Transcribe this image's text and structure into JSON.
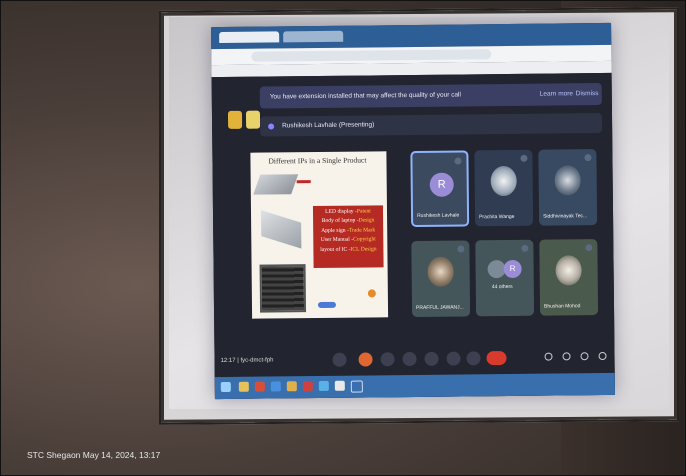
{
  "meeting_code": "fyc-dmct-fph",
  "time": "12:17",
  "banner": {
    "message": "You have extension installed that may affect the quality of your call",
    "learn_more": "Learn more",
    "dismiss": "Dismiss"
  },
  "presenter_label": "Rushikesh Lavhale (Presenting)",
  "slide": {
    "title": "Different IPs in a Single Product",
    "lines": [
      {
        "text": "LED display -",
        "value": "Patent"
      },
      {
        "text": "Body of laptop -",
        "value": "Design"
      },
      {
        "text": "Apple sign -",
        "value": "Trade Mark"
      },
      {
        "text": "User Manual -",
        "value": "Copyright"
      },
      {
        "text": "layout of IC -",
        "value": "ICL Design"
      }
    ]
  },
  "participants": [
    {
      "name": "Rushikesh Lavhale",
      "initial": "R"
    },
    {
      "name": "Prachita Wange",
      "initial": ""
    },
    {
      "name": "Siddhivinayak Tec...",
      "initial": ""
    },
    {
      "name": "PRAFFUL JAWANJ...",
      "initial": ""
    },
    {
      "name": "44 others",
      "initial": "R"
    },
    {
      "name": "Bhushan Mohod",
      "initial": ""
    }
  ],
  "colors": {
    "meet_bg": "#22242f",
    "end_call": "#d93a2e",
    "browser_blue": "#2d5f96"
  },
  "photo_caption": "STC Shegaon  May 14, 2024, 13:17"
}
